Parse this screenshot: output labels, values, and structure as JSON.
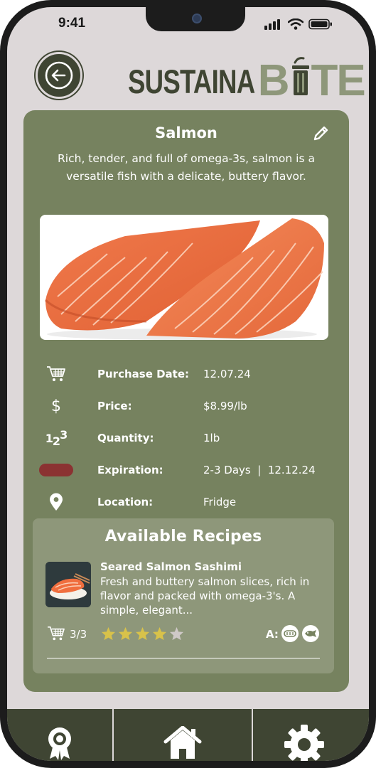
{
  "status_bar": {
    "time": "9:41"
  },
  "header": {
    "logo_part1": "SUSTAINA",
    "logo_part2": "B",
    "logo_part3": "TE"
  },
  "item": {
    "title": "Salmon",
    "description": "Rich, tender, and full of omega-3s, salmon is a versatile fish with a delicate, buttery flavor.",
    "details": [
      {
        "icon": "cart-icon",
        "label": "Purchase Date:",
        "value": "12.07.24"
      },
      {
        "icon": "dollar-icon",
        "label": "Price:",
        "value": "$8.99/lb"
      },
      {
        "icon": "numbers-icon",
        "label": "Quantity:",
        "value": "1lb"
      },
      {
        "icon": "expiration-indicator-icon",
        "label": "Expiration:",
        "value": "2-3 Days  |  12.12.24"
      },
      {
        "icon": "location-pin-icon",
        "label": "Location:",
        "value": "Fridge"
      }
    ],
    "quantity_icon_text": "123",
    "expiration_color": "#8b3232"
  },
  "recipes": {
    "title": "Available Recipes",
    "items": [
      {
        "name": "Seared Salmon Sashimi",
        "description": "Fresh and buttery salmon slices, rich in flavor and packed with omega-3's. A simple, elegant...",
        "ingredients_available": "3/3",
        "rating": 4,
        "max_rating": 5,
        "allergen_label": "A:",
        "allergen_icons": [
          "gluten-icon",
          "fish-allergen-icon"
        ]
      }
    ]
  },
  "colors": {
    "card": "#76825f",
    "panel": "#8e977a",
    "dark": "#3f4533",
    "logo_accent": "#8e977a",
    "star_filled": "#d8c24a",
    "star_empty": "#cfc9c7"
  },
  "navbar": {
    "items": [
      "badge-icon",
      "home-icon",
      "settings-icon"
    ]
  }
}
